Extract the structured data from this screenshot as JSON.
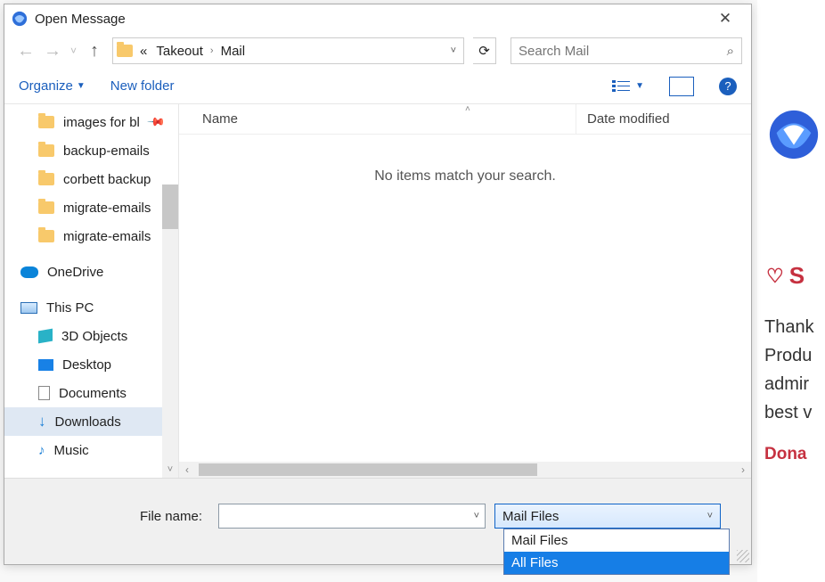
{
  "dialog": {
    "title": "Open Message",
    "close_glyph": "✕"
  },
  "nav": {
    "crumb_prefix": "«",
    "crumb1": "Takeout",
    "crumb2": "Mail",
    "refresh_glyph": "⟳"
  },
  "search": {
    "placeholder": "Search Mail",
    "icon_glyph": "⌕"
  },
  "toolbar": {
    "organize": "Organize",
    "newfolder": "New folder"
  },
  "columns": {
    "name": "Name",
    "date": "Date modified"
  },
  "empty_message": "No items match your search.",
  "sidebar": {
    "items": [
      {
        "label": "images for bl",
        "icon": "folder",
        "pinned": true
      },
      {
        "label": "backup-emails",
        "icon": "folder"
      },
      {
        "label": "corbett backup",
        "icon": "folder"
      },
      {
        "label": "migrate-emails",
        "icon": "folder"
      },
      {
        "label": "migrate-emails",
        "icon": "folder"
      }
    ],
    "onedrive": "OneDrive",
    "thispc": "This PC",
    "pcitems": [
      {
        "label": "3D Objects",
        "icon": "obj3d"
      },
      {
        "label": "Desktop",
        "icon": "desk"
      },
      {
        "label": "Documents",
        "icon": "doc"
      },
      {
        "label": "Downloads",
        "icon": "dl",
        "selected": true
      },
      {
        "label": "Music",
        "icon": "music"
      }
    ]
  },
  "filerow": {
    "label": "File name:",
    "value": ""
  },
  "filter": {
    "selected": "Mail Files",
    "options": [
      "Mail Files",
      "All Files"
    ],
    "highlighted": 1
  },
  "behind": {
    "s_letter": "S",
    "paragraph": "Thank\nProdu\nadmin\nbest v",
    "donate": "Dona"
  }
}
